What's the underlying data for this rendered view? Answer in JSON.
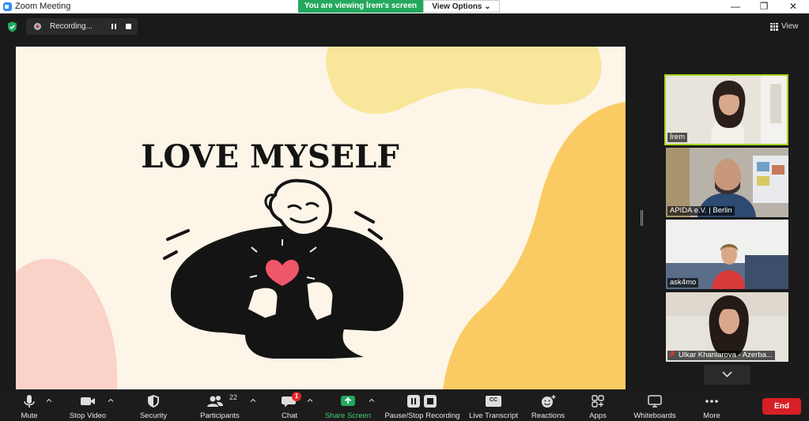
{
  "window": {
    "title": "Zoom Meeting",
    "minimize_glyph": "—",
    "maximize_glyph": "❐",
    "close_glyph": "✕"
  },
  "banner": {
    "message": "You are viewing İrem's screen",
    "view_options_label": "View Options ⌄"
  },
  "recording": {
    "label": "Recording..."
  },
  "view_button": {
    "label": "View"
  },
  "slide": {
    "title": "LOVE MYSELF",
    "colors": {
      "background": "#fdf5e8",
      "yellow_blob": "#f8e69a",
      "orange_blob": "#fbcb63",
      "pink_blob": "#fad2c8",
      "heart": "#f0566a",
      "ink": "#141414"
    }
  },
  "participants": [
    {
      "name": "İrem",
      "active_speaker": true,
      "muted": false
    },
    {
      "name": "APIDA e.V. | Berlin",
      "active_speaker": false,
      "muted": false
    },
    {
      "name": "ask4mo",
      "active_speaker": false,
      "muted": false
    },
    {
      "name": "Ulkar Khanlarova - Azerba...",
      "active_speaker": false,
      "muted": true
    }
  ],
  "toolbar": {
    "mute": "Mute",
    "stop_video": "Stop Video",
    "security": "Security",
    "participants": "Participants",
    "participants_count": "22",
    "chat": "Chat",
    "chat_badge": "1",
    "share_screen": "Share Screen",
    "pause_stop_recording": "Pause/Stop Recording",
    "live_transcript": "Live Transcript",
    "live_transcript_icon_text": "CC",
    "reactions": "Reactions",
    "apps": "Apps",
    "whiteboards": "Whiteboards",
    "more": "More",
    "end": "End"
  },
  "colors": {
    "share_green": "#23a85e",
    "active_speaker_border": "#a6d41c",
    "end_red": "#d71f25"
  }
}
